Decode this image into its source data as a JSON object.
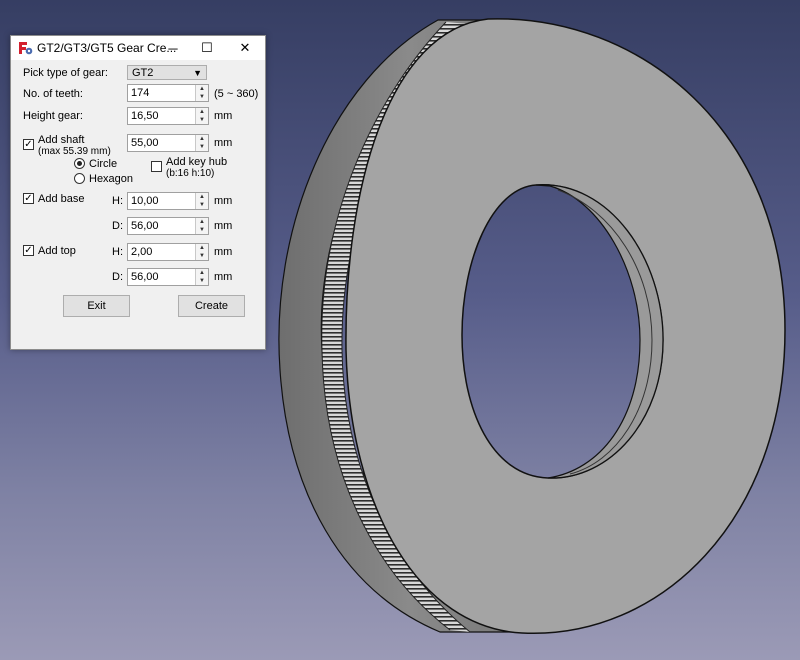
{
  "window": {
    "title": "GT2/GT3/GT5 Gear Cre...",
    "minimize_glyph": "─",
    "maximize_glyph": "☐",
    "close_glyph": "✕"
  },
  "form": {
    "gear_type": {
      "label": "Pick type of gear:",
      "value": "GT2"
    },
    "teeth": {
      "label": "No. of teeth:",
      "value": "174",
      "range_hint": "(5 ~ 360)"
    },
    "height": {
      "label": "Height gear:",
      "value": "16,50",
      "unit": "mm"
    },
    "shaft": {
      "label": "Add shaft",
      "sublabel": "(max 55.39 mm)",
      "checked": true,
      "value": "55,00",
      "unit": "mm",
      "shape_options": [
        {
          "label": "Circle",
          "selected": true
        },
        {
          "label": "Hexagon",
          "selected": false
        }
      ],
      "key_hub": {
        "label": "Add key hub",
        "sublabel": "(b:16 h:10)",
        "checked": false
      }
    },
    "base": {
      "label": "Add base",
      "checked": true,
      "h_label": "H:",
      "h_value": "10,00",
      "d_label": "D:",
      "d_value": "56,00",
      "unit": "mm"
    },
    "top": {
      "label": "Add top",
      "checked": true,
      "h_label": "H:",
      "h_value": "2,00",
      "d_label": "D:",
      "d_value": "56,00",
      "unit": "mm"
    },
    "exit_label": "Exit",
    "create_label": "Create"
  },
  "colors": {
    "bg_top": "#363e63",
    "bg_bottom": "#9b9ab6",
    "gear_face": "#a4a4a4",
    "gear_side": "#7c7c7c",
    "app_icon_red": "#d3202e",
    "app_icon_blue": "#4a6bb0"
  }
}
